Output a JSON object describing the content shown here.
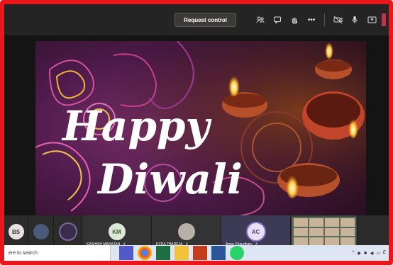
{
  "toolbar": {
    "request_control_label": "Request control",
    "icons": [
      "people-icon",
      "chat-icon",
      "raise-hand-icon",
      "more-options-icon",
      "camera-off-icon",
      "microphone-icon",
      "share-screen-icon",
      "leave-icon"
    ],
    "more_label": "•••"
  },
  "stage": {
    "greeting_line1": "Happy",
    "greeting_line2": "Diwali"
  },
  "participants": [
    {
      "initials": "BS",
      "name": "",
      "color": "#e8e1e1",
      "text": "#3b3b3b"
    },
    {
      "initials": "",
      "name": "",
      "color": "#4a5a7a",
      "text": "#fff"
    },
    {
      "initials": "",
      "name": "",
      "color": "#3c2c4c",
      "text": "#fff"
    },
    {
      "initials": "KM",
      "name": "KASHISH MAHAJAN",
      "color": "#dbe8d5",
      "text": "#3f5e2e"
    },
    {
      "initials": "",
      "name": "KYRA THAREJA",
      "color": "#b8b1a8",
      "text": "#fff"
    },
    {
      "initials": "AC",
      "name": "Annu Chaudhary",
      "color": "#e9e1f3",
      "text": "#5b3f7b"
    }
  ],
  "taskbar": {
    "search_text": "ere to search",
    "apps": [
      "teams-icon",
      "chrome-icon",
      "excel-icon",
      "explorer-icon",
      "powerpoint-icon",
      "word-icon",
      "whatsapp-icon"
    ],
    "tray_text": "E"
  }
}
